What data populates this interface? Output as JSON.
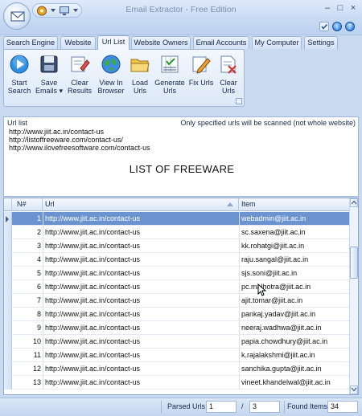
{
  "window": {
    "title": "Email Extractor - Free Edition"
  },
  "tabs": [
    {
      "label": "Search Engine"
    },
    {
      "label": "Website"
    },
    {
      "label": "Url List",
      "active": true
    },
    {
      "label": "Website Owners"
    },
    {
      "label": "Email Accounts"
    },
    {
      "label": "My Computer"
    },
    {
      "label": "Settings"
    }
  ],
  "ribbon": {
    "buttons": [
      {
        "label": "Start Search",
        "icon": "play-icon"
      },
      {
        "label": "Save Emails ▾",
        "icon": "floppy-disk-icon"
      },
      {
        "label": "Clear Results",
        "icon": "clear-eraser-icon"
      },
      {
        "label": "View In Browser",
        "icon": "globe-icon"
      },
      {
        "label": "Load Urls",
        "icon": "folder-icon"
      },
      {
        "label": "Generate Urls",
        "icon": "generate-list-icon"
      },
      {
        "label": "Fix Urls",
        "icon": "pencil-icon"
      },
      {
        "label": "Clear Urls",
        "icon": "clear-document-icon"
      }
    ]
  },
  "url_panel": {
    "caption": "Url list",
    "note": "Only specified urls will be scanned (not whole website)",
    "urls": [
      "http://www.jiit.ac.in/contact-us",
      "http://listoffreeware.com/contact-us/",
      "http://www.ilovefreesoftware.com/contact-us"
    ],
    "heading": "LIST OF FREEWARE"
  },
  "grid": {
    "columns": {
      "num": "N#",
      "url": "Url",
      "item": "Item"
    },
    "rows": [
      {
        "num": "1",
        "url": "http://www.jiit.ac.in/contact-us",
        "item": "webadmin@jiit.ac.in",
        "selected": true
      },
      {
        "num": "2",
        "url": "http://www.jiit.ac.in/contact-us",
        "item": "sc.saxena@jiit.ac.in"
      },
      {
        "num": "3",
        "url": "http://www.jiit.ac.in/contact-us",
        "item": "kk.rohatgi@jiit.ac.in"
      },
      {
        "num": "4",
        "url": "http://www.jiit.ac.in/contact-us",
        "item": "raju.sangal@jiit.ac.in"
      },
      {
        "num": "5",
        "url": "http://www.jiit.ac.in/contact-us",
        "item": "sjs.soni@jiit.ac.in"
      },
      {
        "num": "6",
        "url": "http://www.jiit.ac.in/contact-us",
        "item": "pc.malhotra@jiit.ac.in"
      },
      {
        "num": "7",
        "url": "http://www.jiit.ac.in/contact-us",
        "item": "ajit.tomar@jiit.ac.in"
      },
      {
        "num": "8",
        "url": "http://www.jiit.ac.in/contact-us",
        "item": "pankaj.yadav@jiit.ac.in"
      },
      {
        "num": "9",
        "url": "http://www.jiit.ac.in/contact-us",
        "item": "neeraj.wadhwa@jiit.ac.in"
      },
      {
        "num": "10",
        "url": "http://www.jiit.ac.in/contact-us",
        "item": "papia.chowdhury@jiit.ac.in"
      },
      {
        "num": "11",
        "url": "http://www.jiit.ac.in/contact-us",
        "item": "k.rajalakshmi@jiit.ac.in"
      },
      {
        "num": "12",
        "url": "http://www.jiit.ac.in/contact-us",
        "item": "sanchika.gupta@jiit.ac.in"
      },
      {
        "num": "13",
        "url": "http://www.jiit.ac.in/contact-us",
        "item": "vineet.khandelwal@jiit.ac.in"
      }
    ]
  },
  "status": {
    "parsed_label": "Parsed Urls",
    "parsed_value": "1",
    "separator": "/",
    "total_value": "3",
    "found_label": "Found Items",
    "found_value": "34"
  },
  "colors": {
    "accent": "#6b93cf",
    "frame": "#c9daf0",
    "ribbon_border": "#9fb8da"
  }
}
